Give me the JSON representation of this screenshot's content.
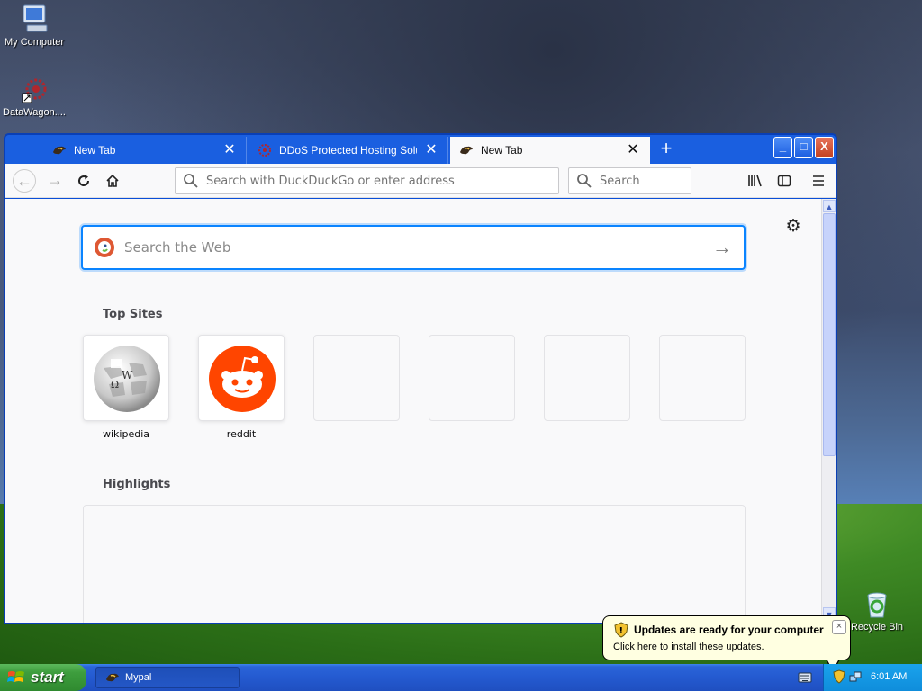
{
  "desktop": {
    "icons": [
      {
        "label": "My Computer",
        "icon": "computer-icon"
      },
      {
        "label": "DataWagon....",
        "icon": "datawagon-icon"
      },
      {
        "label": "Recycle Bin",
        "icon": "recycle-bin-icon"
      }
    ]
  },
  "browser": {
    "tabs": [
      {
        "title": "New Tab",
        "icon": "mypal-icon",
        "active": false
      },
      {
        "title": "DDoS Protected Hosting Solutions",
        "icon": "datawagon-favicon",
        "active": false
      },
      {
        "title": "New Tab",
        "icon": "mypal-icon",
        "active": true
      }
    ],
    "new_tab_label": "+",
    "window_buttons": {
      "minimize": "_",
      "maximize": "□",
      "close": "X"
    },
    "url_placeholder": "Search with DuckDuckGo or enter address",
    "search_placeholder": "Search",
    "content": {
      "web_search_placeholder": "Search the Web",
      "top_sites_title": "Top Sites",
      "top_sites": [
        {
          "label": "wikipedia",
          "icon": "wikipedia-icon"
        },
        {
          "label": "reddit",
          "icon": "reddit-icon"
        },
        {
          "label": "",
          "icon": ""
        },
        {
          "label": "",
          "icon": ""
        },
        {
          "label": "",
          "icon": ""
        },
        {
          "label": "",
          "icon": ""
        }
      ],
      "highlights_title": "Highlights"
    },
    "accent_color": "#0a84ff"
  },
  "taskbar": {
    "start_label": "start",
    "task_button_label": "Mypal",
    "clock": "6:01 AM"
  },
  "notification": {
    "title": "Updates are ready for your computer",
    "body": "Click here to install these updates.",
    "close": "×"
  }
}
